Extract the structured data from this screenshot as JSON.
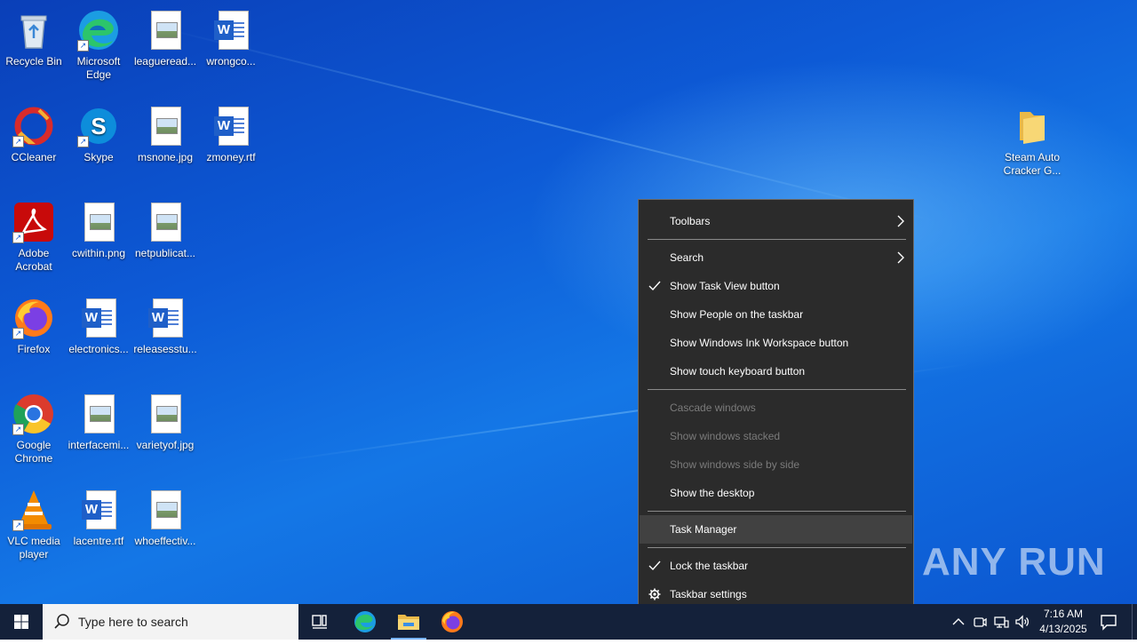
{
  "desktop": {
    "icons": [
      {
        "label": "Recycle Bin",
        "icon": "recycle-bin-icon"
      },
      {
        "label": "Microsoft Edge",
        "icon": "edge-icon"
      },
      {
        "label": "leagueread...",
        "icon": "image-file-icon"
      },
      {
        "label": "wrongco...",
        "icon": "word-document-icon"
      },
      {
        "label": "CCleaner",
        "icon": "ccleaner-icon"
      },
      {
        "label": "Skype",
        "icon": "skype-icon"
      },
      {
        "label": "msnone.jpg",
        "icon": "image-file-icon"
      },
      {
        "label": "zmoney.rtf",
        "icon": "word-document-icon"
      },
      {
        "label": "Adobe Acrobat",
        "icon": "adobe-acrobat-icon"
      },
      {
        "label": "cwithin.png",
        "icon": "image-file-icon"
      },
      {
        "label": "netpublicat...",
        "icon": "image-file-icon"
      },
      {
        "label": "Firefox",
        "icon": "firefox-icon"
      },
      {
        "label": "electronics...",
        "icon": "word-document-icon"
      },
      {
        "label": "releasesstu...",
        "icon": "word-document-icon"
      },
      {
        "label": "Google Chrome",
        "icon": "chrome-icon"
      },
      {
        "label": "interfacemi...",
        "icon": "image-file-icon"
      },
      {
        "label": "varietyof.jpg",
        "icon": "image-file-icon"
      },
      {
        "label": "VLC media player",
        "icon": "vlc-icon"
      },
      {
        "label": "lacentre.rtf",
        "icon": "word-document-icon"
      },
      {
        "label": "whoeffectiv...",
        "icon": "image-file-icon"
      },
      {
        "label": "Steam Auto Cracker G...",
        "icon": "folder-icon"
      }
    ]
  },
  "context_menu": {
    "items": [
      {
        "label": "Toolbars",
        "submenu": true
      },
      {
        "label": "Search",
        "submenu": true
      },
      {
        "label": "Show Task View button",
        "checked": true
      },
      {
        "label": "Show People on the taskbar"
      },
      {
        "label": "Show Windows Ink Workspace button"
      },
      {
        "label": "Show touch keyboard button"
      },
      {
        "label": "Cascade windows",
        "disabled": true
      },
      {
        "label": "Show windows stacked",
        "disabled": true
      },
      {
        "label": "Show windows side by side",
        "disabled": true
      },
      {
        "label": "Show the desktop"
      },
      {
        "label": "Task Manager",
        "highlighted": true
      },
      {
        "label": "Lock the taskbar",
        "checked": true
      },
      {
        "label": "Taskbar settings",
        "icon": "gear-icon"
      }
    ]
  },
  "taskbar": {
    "search_placeholder": "Type here to search",
    "pinned": [
      "task-view-icon",
      "edge-icon",
      "file-explorer-icon",
      "firefox-icon"
    ],
    "time": "7:16 AM",
    "date": "4/13/2025"
  },
  "watermark": "ANY RUN",
  "colors": {
    "menu_bg": "#2b2b2b",
    "menu_highlight": "#414141",
    "taskbar_bg": "#14213a",
    "desktop_blue": "#0d5ad6"
  }
}
